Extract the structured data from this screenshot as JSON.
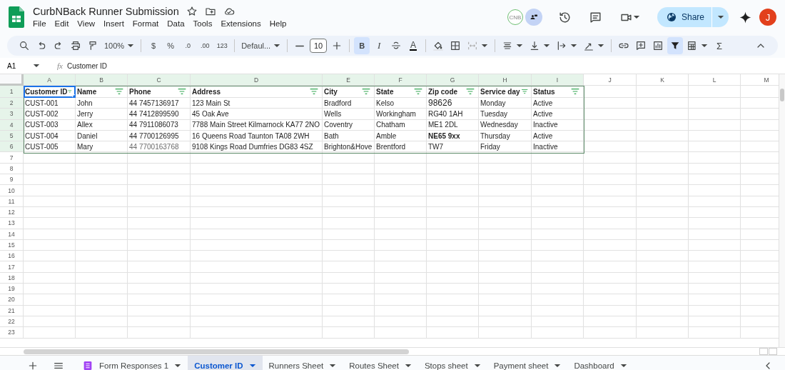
{
  "document": {
    "title": "CurbNBack Runner Submission"
  },
  "menu": [
    "File",
    "Edit",
    "View",
    "Insert",
    "Format",
    "Data",
    "Tools",
    "Extensions",
    "Help"
  ],
  "collaborator": {
    "initials": "CNB"
  },
  "share": {
    "label": "Share"
  },
  "account": {
    "initial": "J"
  },
  "toolbar": {
    "zoom": "100%",
    "currency": "$",
    "percent": "%",
    "decrease_decimal": ".0",
    "increase_decimal": ".00",
    "number_format": "123",
    "font": "Defaul...",
    "font_size": "10",
    "bold": {
      "label": "B",
      "on": true
    },
    "italic": "I",
    "text_color": "A",
    "filter_on": true,
    "functions": "Σ"
  },
  "formula_bar": {
    "cell": "A1",
    "fx": "fx",
    "value": "Customer ID"
  },
  "grid": {
    "columns": [
      {
        "letter": "A",
        "in_filter": true
      },
      {
        "letter": "B",
        "in_filter": true
      },
      {
        "letter": "C",
        "in_filter": true
      },
      {
        "letter": "D",
        "in_filter": true
      },
      {
        "letter": "E",
        "in_filter": true
      },
      {
        "letter": "F",
        "in_filter": true
      },
      {
        "letter": "G",
        "in_filter": true
      },
      {
        "letter": "H",
        "in_filter": true
      },
      {
        "letter": "I",
        "in_filter": true
      },
      {
        "letter": "J",
        "in_filter": false
      },
      {
        "letter": "K",
        "in_filter": false
      },
      {
        "letter": "L",
        "in_filter": false
      },
      {
        "letter": "M",
        "in_filter": false
      }
    ],
    "rows": [
      {
        "number": "1",
        "in_filter": true,
        "cells": [
          {
            "text": "Customer ID",
            "kind": "header",
            "selected": true
          },
          {
            "text": "Name",
            "kind": "header",
            "selected": false
          },
          {
            "text": "Phone",
            "kind": "header",
            "selected": false
          },
          {
            "text": "Address",
            "kind": "header",
            "selected": false
          },
          {
            "text": "City",
            "kind": "header",
            "selected": false
          },
          {
            "text": "State",
            "kind": "header",
            "selected": false
          },
          {
            "text": "Zip code",
            "kind": "header",
            "selected": false
          },
          {
            "text": "Service day",
            "kind": "header",
            "selected": false
          },
          {
            "text": "Status",
            "kind": "header",
            "selected": false
          }
        ]
      },
      {
        "number": "2",
        "in_filter": true,
        "cells": [
          {
            "text": "CUST-001",
            "kind": "plain",
            "selected": false
          },
          {
            "text": "John",
            "kind": "plain",
            "selected": false
          },
          {
            "text": "44 7457136917",
            "kind": "plain",
            "selected": false
          },
          {
            "text": "123 Main St",
            "kind": "plain",
            "selected": false
          },
          {
            "text": "Bradford",
            "kind": "plain",
            "selected": false
          },
          {
            "text": "Kelso",
            "kind": "plain",
            "selected": false
          },
          {
            "text": "98626",
            "kind": "large",
            "selected": false
          },
          {
            "text": "Monday",
            "kind": "plain",
            "selected": false
          },
          {
            "text": "Active",
            "kind": "plain",
            "selected": false
          }
        ]
      },
      {
        "number": "3",
        "in_filter": true,
        "cells": [
          {
            "text": "CUST-002",
            "kind": "plain",
            "selected": false
          },
          {
            "text": "Jerry",
            "kind": "plain",
            "selected": false
          },
          {
            "text": "44 7412899590",
            "kind": "plain",
            "selected": false
          },
          {
            "text": "45 Oak Ave",
            "kind": "plain",
            "selected": false
          },
          {
            "text": "Wells",
            "kind": "plain",
            "selected": false
          },
          {
            "text": "Workingham",
            "kind": "plain",
            "selected": false
          },
          {
            "text": "RG40 1AH",
            "kind": "plain",
            "selected": false
          },
          {
            "text": "Tuesday",
            "kind": "plain",
            "selected": false
          },
          {
            "text": "Active",
            "kind": "plain",
            "selected": false
          }
        ]
      },
      {
        "number": "4",
        "in_filter": true,
        "cells": [
          {
            "text": "CUST-003",
            "kind": "plain",
            "selected": false
          },
          {
            "text": "Allex",
            "kind": "plain",
            "selected": false
          },
          {
            "text": "44 7911086073",
            "kind": "plain",
            "selected": false
          },
          {
            "text": "7788 Main Street Kilmarnock KA77 2NO",
            "kind": "plain",
            "selected": false
          },
          {
            "text": "Coventry",
            "kind": "plain",
            "selected": false
          },
          {
            "text": "Chatham",
            "kind": "plain",
            "selected": false
          },
          {
            "text": "ME1 2DL",
            "kind": "plain",
            "selected": false
          },
          {
            "text": "Wednesday",
            "kind": "plain",
            "selected": false
          },
          {
            "text": "Inactive",
            "kind": "plain",
            "selected": false
          }
        ]
      },
      {
        "number": "5",
        "in_filter": true,
        "cells": [
          {
            "text": "CUST-004",
            "kind": "plain",
            "selected": false
          },
          {
            "text": "Daniel",
            "kind": "plain",
            "selected": false
          },
          {
            "text": "44 7700126995",
            "kind": "plain",
            "selected": false
          },
          {
            "text": "16 Queens Road Taunton TA08 2WH",
            "kind": "plain",
            "selected": false
          },
          {
            "text": "Bath",
            "kind": "plain",
            "selected": false
          },
          {
            "text": "Amble",
            "kind": "plain",
            "selected": false
          },
          {
            "text": "NE65 9xx",
            "kind": "bold",
            "selected": false
          },
          {
            "text": "Thursday",
            "kind": "plain",
            "selected": false
          },
          {
            "text": "Active",
            "kind": "plain",
            "selected": false
          }
        ]
      },
      {
        "number": "6",
        "in_filter": true,
        "cells": [
          {
            "text": "CUST-005",
            "kind": "plain",
            "selected": false
          },
          {
            "text": "Mary",
            "kind": "plain",
            "selected": false
          },
          {
            "text": "44 7700163768",
            "kind": "muted",
            "selected": false
          },
          {
            "text": "9108 Kings Road Dumfries DG83 4SZ",
            "kind": "plain",
            "selected": false
          },
          {
            "text": "Brighton&Hove",
            "kind": "plain",
            "selected": false
          },
          {
            "text": "Brentford",
            "kind": "plain",
            "selected": false
          },
          {
            "text": "TW7",
            "kind": "plain",
            "selected": false
          },
          {
            "text": "Friday",
            "kind": "plain",
            "selected": false
          },
          {
            "text": "Inactive",
            "kind": "plain",
            "selected": false
          }
        ]
      },
      {
        "number": "7",
        "in_filter": false
      },
      {
        "number": "8",
        "in_filter": false
      },
      {
        "number": "9",
        "in_filter": false
      },
      {
        "number": "10",
        "in_filter": false
      },
      {
        "number": "11",
        "in_filter": false
      },
      {
        "number": "12",
        "in_filter": false
      },
      {
        "number": "13",
        "in_filter": false
      },
      {
        "number": "14",
        "in_filter": false
      },
      {
        "number": "15",
        "in_filter": false
      },
      {
        "number": "16",
        "in_filter": false
      },
      {
        "number": "17",
        "in_filter": false
      },
      {
        "number": "18",
        "in_filter": false
      },
      {
        "number": "19",
        "in_filter": false
      },
      {
        "number": "20",
        "in_filter": false
      },
      {
        "number": "21",
        "in_filter": false
      },
      {
        "number": "22",
        "in_filter": false
      },
      {
        "number": "23",
        "in_filter": false
      }
    ]
  },
  "sheet_tabs": [
    {
      "label": "Form Responses 1",
      "kind": "form",
      "selected": false
    },
    {
      "label": "Customer ID",
      "kind": "sheet",
      "selected": true
    },
    {
      "label": "Runners Sheet",
      "kind": "sheet",
      "selected": false
    },
    {
      "label": "Routes Sheet",
      "kind": "sheet",
      "selected": false
    },
    {
      "label": "Stops sheet",
      "kind": "sheet",
      "selected": false
    },
    {
      "label": "Payment sheet",
      "kind": "sheet",
      "selected": false
    },
    {
      "label": "Dashboard",
      "kind": "sheet",
      "selected": false
    }
  ]
}
